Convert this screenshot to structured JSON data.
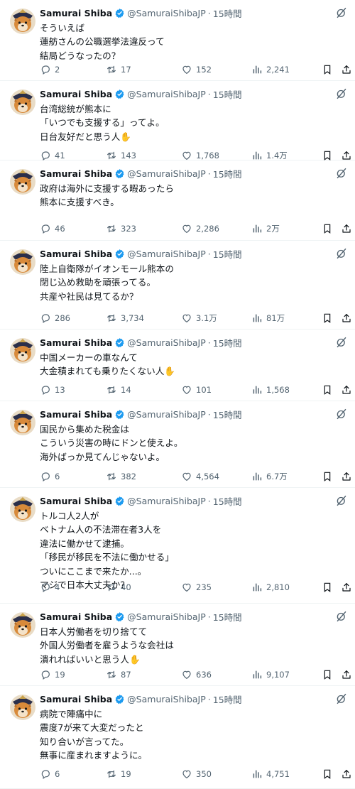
{
  "author": {
    "name": "Samurai Shiba",
    "handle": "@SamuraiShibaJP",
    "separator": "·"
  },
  "icons": {
    "reply": "reply-icon",
    "retweet": "retweet-icon",
    "like": "heart-icon",
    "views": "analytics-icon",
    "bookmark": "bookmark-icon",
    "share": "share-icon",
    "grok": "grok-icon",
    "verified": "verified-badge-icon"
  },
  "colors": {
    "verified": "#1d9bf0",
    "text": "#0f1419",
    "muted": "#536471",
    "divider": "#eff3f4"
  },
  "tweets": [
    {
      "time": "15時間",
      "lines": [
        "そういえば",
        "蓮舫さんの公職選挙法違反って",
        "結局どうなったの？"
      ],
      "replies": "2",
      "retweets": "17",
      "likes": "152",
      "views": "2,241"
    },
    {
      "time": "15時間",
      "lines": [
        "台湾総統が熊本に",
        "「いつでも支援する」ってよ。",
        "日台友好だと思う人✋"
      ],
      "replies": "41",
      "retweets": "143",
      "likes": "1,768",
      "views": "1.4万"
    },
    {
      "time": "15時間",
      "lines": [
        "政府は海外に支援する暇あったら",
        "熊本に支援すべき。"
      ],
      "replies": "46",
      "retweets": "323",
      "likes": "2,286",
      "views": "2万"
    },
    {
      "time": "15時間",
      "lines": [
        "陸上自衛隊がイオンモール熊本の",
        "閉じ込め救助を頑張ってる。",
        "共産や社民は見てるか？"
      ],
      "replies": "286",
      "retweets": "3,734",
      "likes": "3.1万",
      "views": "81万"
    },
    {
      "time": "15時間",
      "lines": [
        "中国メーカーの車なんて",
        "大金積まれても乗りたくない人✋"
      ],
      "replies": "13",
      "retweets": "14",
      "likes": "101",
      "views": "1,568"
    },
    {
      "time": "15時間",
      "lines": [
        "国民から集めた税金は",
        "こういう災害の時にドンと使えよ。",
        "海外ばっか見てんじゃないよ。"
      ],
      "replies": "6",
      "retweets": "382",
      "likes": "4,564",
      "views": "6.7万"
    },
    {
      "time": "15時間",
      "lines": [
        "トルコ人2人が",
        "ベトナム人の不法滞在者3人を",
        "違法に働かせて逮捕。",
        "「移民が移民を不法に働かせる」",
        "ついにここまで来たか...。",
        "マジで日本大丈夫か？"
      ],
      "replies": "4",
      "retweets": "40",
      "likes": "235",
      "views": "2,810"
    },
    {
      "time": "15時間",
      "lines": [
        "日本人労働者を切り捨てて",
        "外国人労働者を雇うような会社は",
        "潰れればいいと思う人✋"
      ],
      "replies": "19",
      "retweets": "87",
      "likes": "636",
      "views": "9,107"
    },
    {
      "time": "15時間",
      "lines": [
        "病院で陣痛中に",
        "震度7が来て大変だったと",
        "知り合いが言ってた。",
        "無事に産まれますように。"
      ],
      "replies": "6",
      "retweets": "19",
      "likes": "350",
      "views": "4,751"
    }
  ]
}
